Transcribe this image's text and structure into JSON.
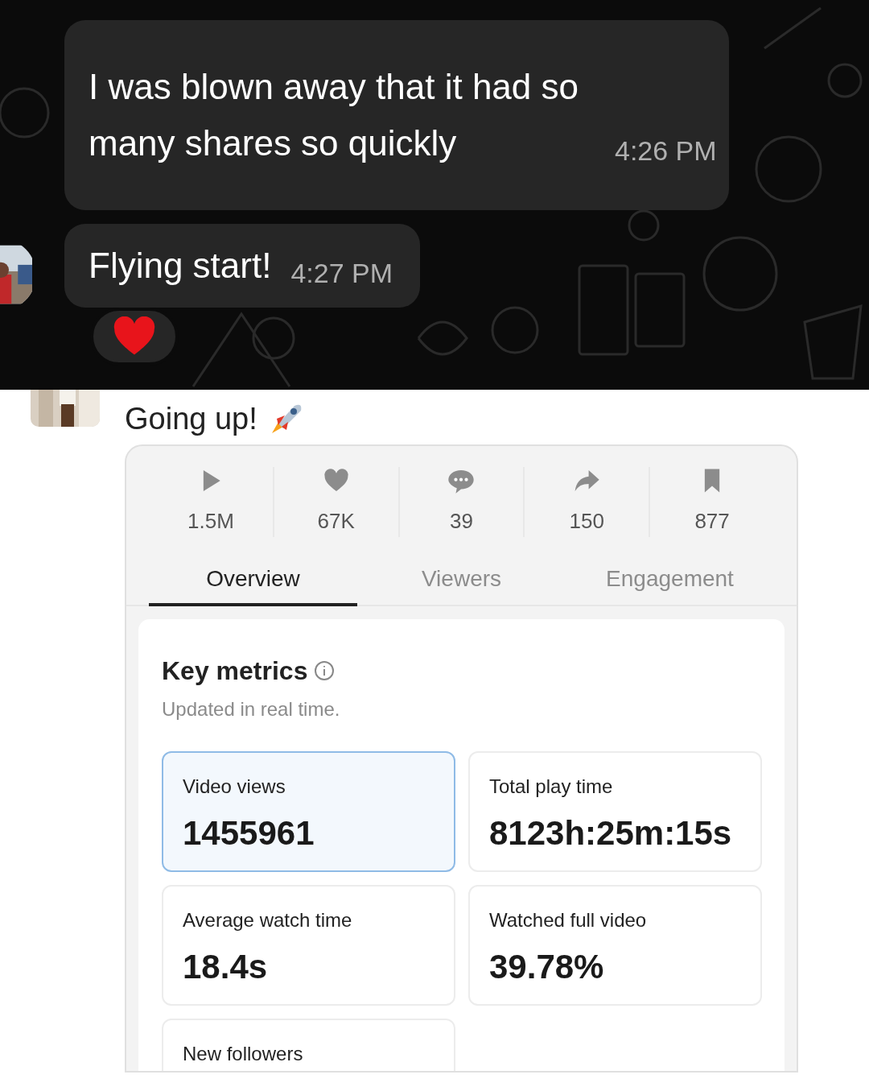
{
  "chat": {
    "messages": [
      {
        "text": "I was blown away that it had so many shares so quickly",
        "time": "4:26 PM",
        "show_avatar": false
      },
      {
        "text": "Flying start!",
        "time": "4:27 PM",
        "show_avatar": true,
        "reactions": [
          {
            "kind": "heart"
          }
        ]
      }
    ]
  },
  "post": {
    "text": "Going up!"
  },
  "stats": [
    {
      "kind": "play",
      "value": "1.5M"
    },
    {
      "kind": "heart",
      "value": "67K"
    },
    {
      "kind": "comment",
      "value": "39"
    },
    {
      "kind": "share",
      "value": "150"
    },
    {
      "kind": "bookmark",
      "value": "877"
    }
  ],
  "tabs": [
    {
      "label": "Overview",
      "selected": true
    },
    {
      "label": "Viewers",
      "selected": false
    },
    {
      "label": "Engagement",
      "selected": false
    }
  ],
  "key_metrics": {
    "title": "Key metrics",
    "subtitle": "Updated in real time.",
    "cards": [
      {
        "label": "Video views",
        "value": "1455961",
        "selected": true
      },
      {
        "label": "Total play time",
        "value": "8123h:25m:15s",
        "selected": false
      },
      {
        "label": "Average watch time",
        "value": "18.4s",
        "selected": false
      },
      {
        "label": "Watched full video",
        "value": "39.78%",
        "selected": false
      },
      {
        "label": "New followers",
        "selected": false
      }
    ]
  }
}
